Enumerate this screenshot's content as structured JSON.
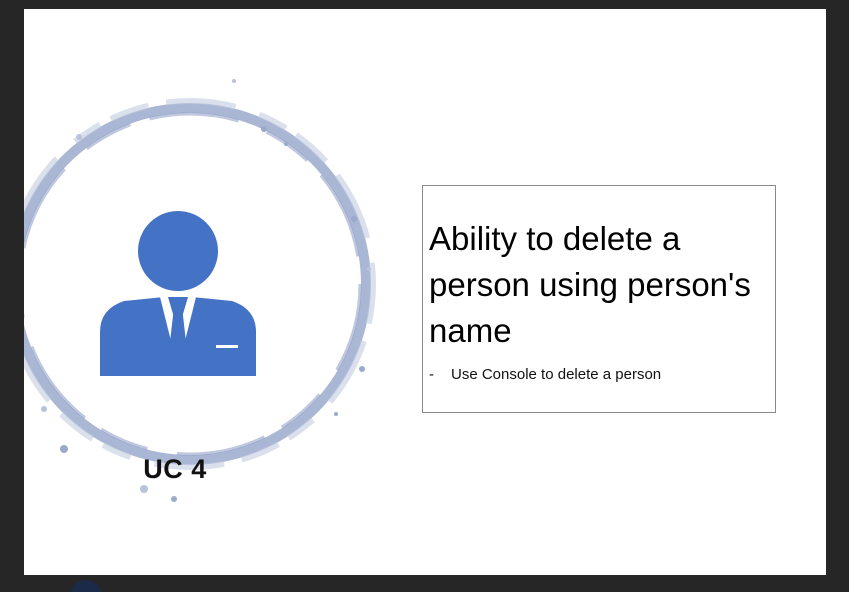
{
  "slide": {
    "uc_label": "UC 4",
    "headline": "Ability to delete a person using person's name",
    "bullet_marker": "-",
    "bullet_text": "Use Console to delete a person"
  },
  "icons": {
    "person": "person-with-tie-icon",
    "ring": "paint-splash-ring"
  },
  "colors": {
    "accent": "#4472C4",
    "ring": "#8E9EC4",
    "frame": "#262626"
  }
}
